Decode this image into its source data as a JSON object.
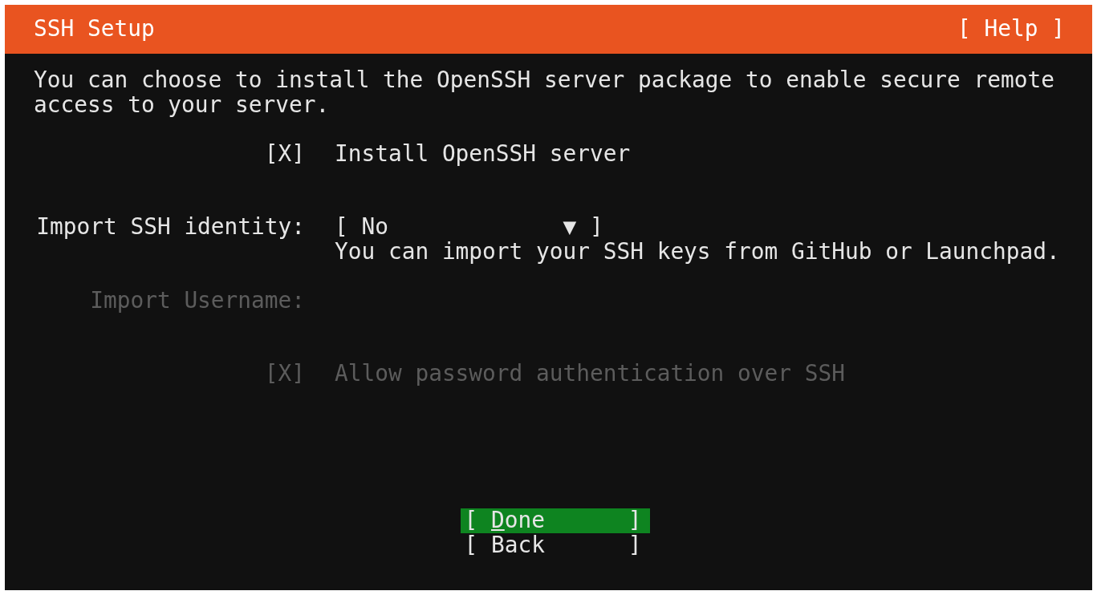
{
  "header": {
    "title": "SSH Setup",
    "help": "[ Help ]"
  },
  "description": "You can choose to install the OpenSSH server package to enable secure remote access to your server.",
  "install_openssh": {
    "open": "[",
    "mark": "X",
    "close": "]",
    "label": "Install OpenSSH server",
    "checked": true,
    "disabled": false
  },
  "import_identity": {
    "label": "Import SSH identity:",
    "open": "[",
    "value": "No",
    "arrow": "▼",
    "close": "]",
    "hint": "You can import your SSH keys from GitHub or Launchpad.",
    "disabled": false
  },
  "import_username": {
    "label": "Import Username:",
    "disabled": true
  },
  "allow_password": {
    "open": "[",
    "mark": "X",
    "close": "]",
    "label": "Allow password authentication over SSH",
    "checked": true,
    "disabled": true
  },
  "buttons": [
    {
      "open": "[",
      "label": "Done",
      "close": "]",
      "selected": true
    },
    {
      "open": "[",
      "label": "Back",
      "close": "]",
      "selected": false
    }
  ]
}
